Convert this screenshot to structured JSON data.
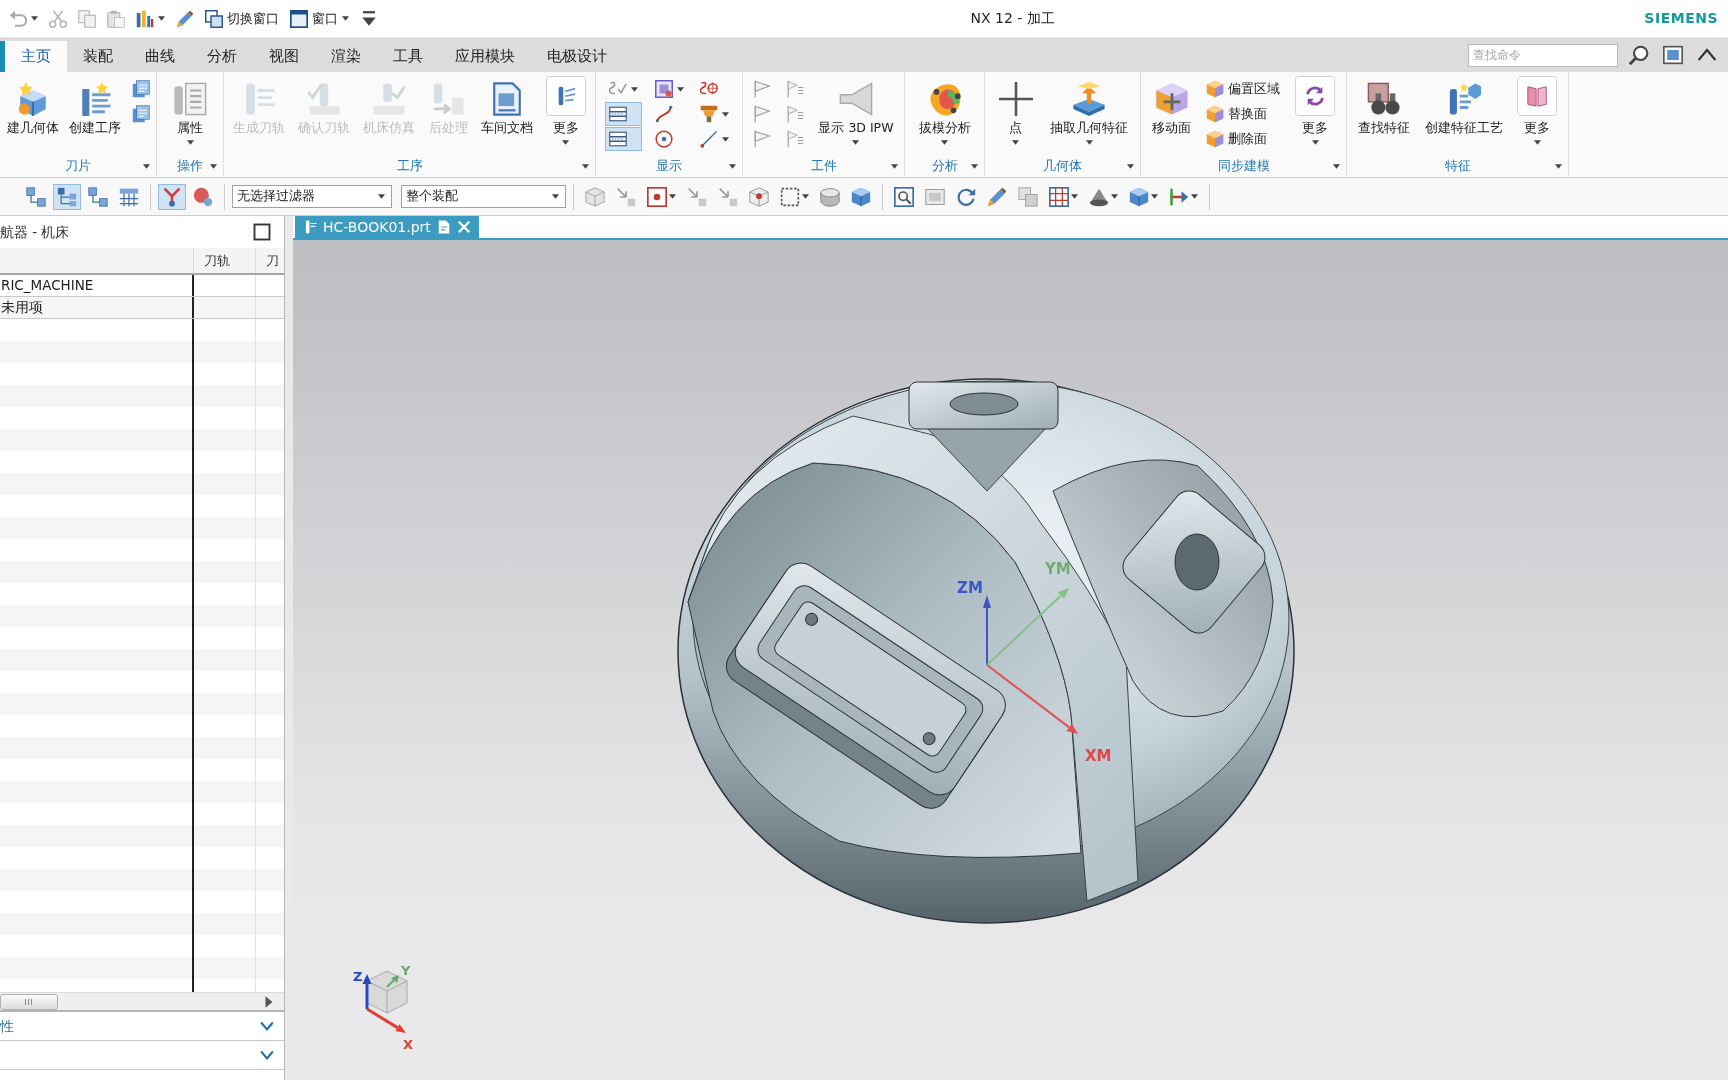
{
  "window": {
    "title": "NX 12 - 加工",
    "brand": "SIEMENS"
  },
  "quick_access": [
    {
      "label": "切换窗口",
      "dropdown": false
    },
    {
      "label": "窗口",
      "dropdown": true
    }
  ],
  "ribbon_tabs": [
    {
      "label": "主页",
      "selected": true
    },
    {
      "label": "装配",
      "selected": false
    },
    {
      "label": "曲线",
      "selected": false
    },
    {
      "label": "分析",
      "selected": false
    },
    {
      "label": "视图",
      "selected": false
    },
    {
      "label": "渲染",
      "selected": false
    },
    {
      "label": "工具",
      "selected": false
    },
    {
      "label": "应用模块",
      "selected": false
    },
    {
      "label": "电极设计",
      "selected": false
    }
  ],
  "command_search": {
    "placeholder": "查找命令"
  },
  "ribbon_groups": [
    {
      "label": "刀片",
      "items": [
        {
          "kind": "large",
          "label": "建几何体",
          "disabled": false,
          "dropdown": false
        },
        {
          "kind": "large",
          "label": "创建工序",
          "disabled": false,
          "dropdown": false
        },
        {
          "kind": "stack",
          "buttons": [
            {
              "on": false,
              "dropdown": false
            },
            {
              "on": false,
              "dropdown": false
            }
          ]
        }
      ]
    },
    {
      "label": "操作",
      "items": [
        {
          "kind": "large",
          "label": "属性",
          "disabled": false,
          "dropdown": true
        }
      ]
    },
    {
      "label": "工序",
      "items": [
        {
          "kind": "large",
          "label": "生成刀轨",
          "disabled": true,
          "dropdown": false
        },
        {
          "kind": "large",
          "label": "确认刀轨",
          "disabled": true,
          "dropdown": false
        },
        {
          "kind": "large",
          "label": "机床仿真",
          "disabled": true,
          "dropdown": false
        },
        {
          "kind": "large",
          "label": "后处理",
          "disabled": true,
          "dropdown": false
        },
        {
          "kind": "large",
          "label": "车间文档",
          "disabled": false,
          "dropdown": false
        },
        {
          "kind": "more",
          "label": "更多",
          "disabled": false,
          "dropdown": true
        }
      ]
    },
    {
      "label": "显示",
      "items": [
        {
          "kind": "stack",
          "buttons": [
            {
              "on": false,
              "dropdown": true
            },
            {
              "on": true,
              "dropdown": false
            },
            {
              "on": true,
              "dropdown": false
            }
          ]
        },
        {
          "kind": "stack",
          "buttons": [
            {
              "on": false,
              "dropdown": true
            },
            {
              "on": false,
              "dropdown": false
            },
            {
              "on": false,
              "dropdown": false
            }
          ]
        },
        {
          "kind": "stack",
          "buttons": [
            {
              "on": false,
              "dropdown": false
            },
            {
              "on": false,
              "dropdown": true
            },
            {
              "on": false,
              "dropdown": true
            }
          ]
        }
      ]
    },
    {
      "label": "工件",
      "items": [
        {
          "kind": "stack",
          "buttons": [
            {
              "on": false,
              "dropdown": false
            },
            {
              "on": false,
              "dropdown": false
            },
            {
              "on": false,
              "dropdown": false
            }
          ]
        },
        {
          "kind": "stack",
          "buttons": [
            {
              "on": false,
              "dropdown": false
            },
            {
              "on": false,
              "dropdown": false
            },
            {
              "on": false,
              "dropdown": false
            }
          ]
        },
        {
          "kind": "large",
          "label": "显示 3D IPW",
          "disabled": false,
          "dropdown": true
        }
      ]
    },
    {
      "label": "分析",
      "items": [
        {
          "kind": "large",
          "label": "拔模分析",
          "disabled": false,
          "dropdown": true
        }
      ]
    },
    {
      "label": "几何体",
      "items": [
        {
          "kind": "large",
          "label": "点",
          "disabled": false,
          "dropdown": true
        },
        {
          "kind": "large",
          "label": "抽取几何特征",
          "disabled": false,
          "dropdown": true
        }
      ]
    },
    {
      "label": "同步建模",
      "items": [
        {
          "kind": "large",
          "label": "移动面",
          "disabled": false,
          "dropdown": false
        },
        {
          "kind": "stack",
          "buttons": [
            {
              "label": "偏置区域",
              "on": false,
              "dropdown": false
            },
            {
              "label": "替换面",
              "on": false,
              "dropdown": false
            },
            {
              "label": "删除面",
              "on": false,
              "dropdown": false
            }
          ]
        },
        {
          "kind": "more",
          "label": "更多",
          "disabled": false,
          "dropdown": true
        }
      ]
    },
    {
      "label": "特征",
      "items": [
        {
          "kind": "large",
          "label": "查找特征",
          "disabled": false,
          "dropdown": false
        },
        {
          "kind": "large",
          "label": "创建特征工艺",
          "disabled": false,
          "dropdown": false
        },
        {
          "kind": "more",
          "label": "更多",
          "disabled": false,
          "dropdown": true
        }
      ]
    }
  ],
  "selection_bar": {
    "left_tool_groups": [
      [
        {
          "on": false
        },
        {
          "on": true
        },
        {
          "on": false
        },
        {
          "on": false
        }
      ],
      [
        {
          "on": true
        },
        {
          "on": false
        }
      ]
    ],
    "type_filter": "无选择过滤器",
    "scope": "整个装配",
    "right_tool_groups": [
      [
        {
          "dropdown": false
        },
        {
          "dropdown": false
        },
        {
          "dropdown": true
        },
        {
          "dropdown": false
        },
        {
          "dropdown": false
        },
        {
          "dropdown": false
        },
        {
          "dropdown": true
        },
        {
          "dropdown": false
        },
        {
          "dropdown": false
        }
      ],
      [
        {
          "dropdown": false
        },
        {
          "dropdown": false
        },
        {
          "dropdown": false
        },
        {
          "dropdown": false
        },
        {
          "dropdown": false
        },
        {
          "dropdown": true
        },
        {
          "dropdown": true
        },
        {
          "dropdown": true
        },
        {
          "dropdown": true
        }
      ]
    ]
  },
  "navigator": {
    "title": "航器 - 机床",
    "columns": [
      {
        "label": "刀轨"
      },
      {
        "label": "刀"
      }
    ],
    "rows": [
      {
        "name": "RIC_MACHINE"
      },
      {
        "name": "未用项"
      }
    ],
    "sections": [
      {
        "label": "性",
        "expanded": false
      },
      {
        "expanded": false
      }
    ]
  },
  "graphics": {
    "tab": "HC-BOOK01.prt",
    "wcs": {
      "z": "ZM",
      "y": "YM",
      "x": "XM"
    },
    "triad": {
      "z": "Z",
      "y": "Y",
      "x": "X"
    }
  }
}
